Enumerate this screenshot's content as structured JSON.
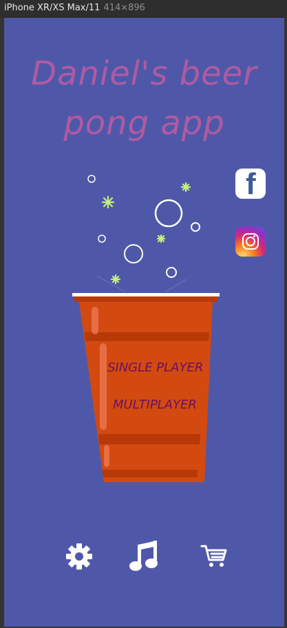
{
  "device_toolbar": {
    "device_name": "iPhone XR/XS Max/11",
    "dimensions": "414×896"
  },
  "app": {
    "title_line1": "Daniel's beer",
    "title_line2": "pong app"
  },
  "social": {
    "facebook_icon": "facebook-icon",
    "instagram_icon": "instagram-icon"
  },
  "menu": {
    "single_player": "SINGLE PLAYER",
    "multiplayer": "MULTIPLAYER"
  },
  "bottom_bar": {
    "icons": [
      "gear-icon",
      "music-note-icon",
      "cart-icon"
    ]
  },
  "colors": {
    "background": "#4f58a8",
    "title": "#b05aa3",
    "cup": "#d24a10",
    "menu_text": "#6b1060"
  }
}
